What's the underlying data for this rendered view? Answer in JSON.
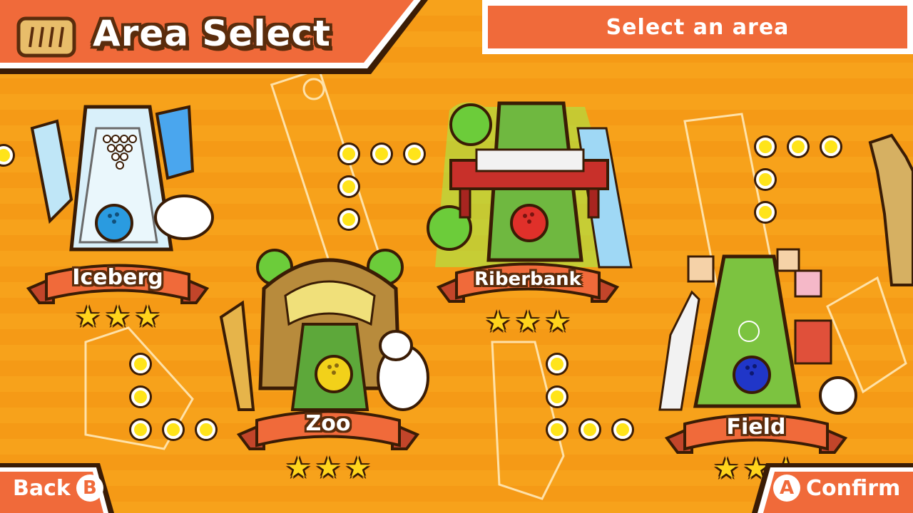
{
  "header": {
    "title": "Area Select",
    "hint": "Select an area",
    "title_icon": "map-scroll-icon"
  },
  "areas": [
    {
      "name": "Iceberg",
      "stars": 3,
      "ball_color": "#2a9be0",
      "selected": false
    },
    {
      "name": "Zoo",
      "stars": 3,
      "ball_color": "#f2d11a",
      "selected": false
    },
    {
      "name": "Riberbank",
      "stars": 3,
      "ball_color": "#e0302a",
      "selected": true
    },
    {
      "name": "Field",
      "stars": 3,
      "ball_color": "#2036c8",
      "selected": false
    }
  ],
  "footer": {
    "back_label": "Back",
    "back_button_glyph": "B",
    "confirm_label": "Confirm",
    "confirm_button_glyph": "A"
  },
  "colors": {
    "accent": "#f06a3a",
    "background": "#f7a21b",
    "outline": "#5a2c0c",
    "star": "#ffd41c",
    "selection_glow": "#9ef04a"
  }
}
